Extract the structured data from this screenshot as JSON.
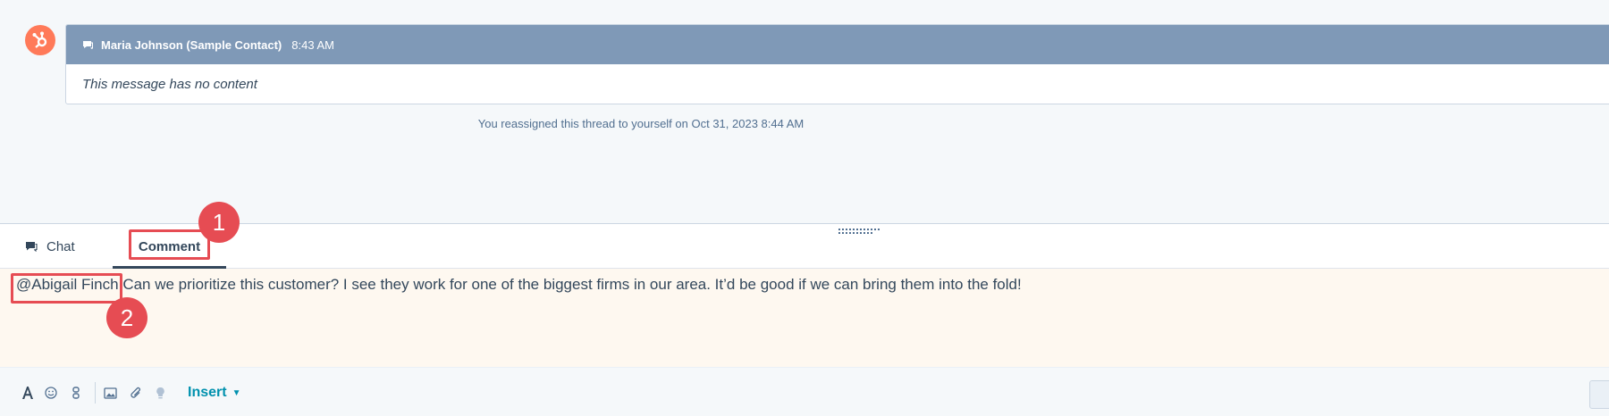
{
  "thread": {
    "message": {
      "sender": "Maria Johnson (Sample Contact)",
      "time": "8:43 AM",
      "body": "This message has no content"
    },
    "system_note": "You reassigned this thread to yourself on Oct 31, 2023 8:44 AM"
  },
  "composer": {
    "tabs": [
      {
        "label": "Chat",
        "icon": "chat-icon"
      },
      {
        "label": "Comment",
        "active": true
      }
    ],
    "comment": {
      "mention": "@Abigail Finch",
      "text": " Can we prioritize this customer? I see they work for one of the biggest firms in our area. It’d be good if we can bring them into the fold!"
    },
    "toolbar": {
      "insert_label": "Insert"
    }
  },
  "annotations": {
    "badge_1": "1",
    "badge_2": "2",
    "highlight_color": "#e64c53"
  },
  "colors": {
    "brand": "#ff7a59",
    "header": "#7f99b7",
    "link": "#0091ae"
  }
}
